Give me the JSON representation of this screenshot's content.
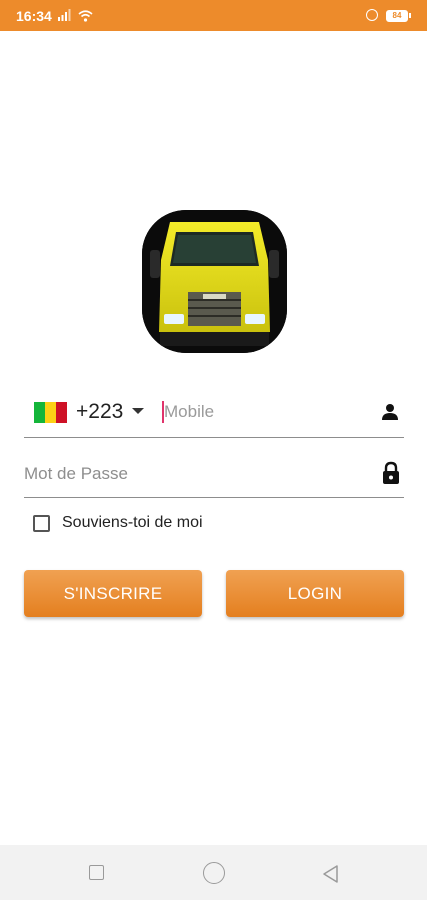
{
  "status_bar": {
    "time": "16:34",
    "battery_level": "84",
    "signal_icon": "signal-icon",
    "wifi_icon": "wifi-icon",
    "alarm_icon": "alarm-icon",
    "background_color": "#ed8b2b"
  },
  "logo": {
    "icon": "yellow-truck-logo"
  },
  "phone": {
    "country_code": "+223",
    "flag_colors": [
      "#14b53a",
      "#fcd116",
      "#ce1126"
    ],
    "mobile_placeholder": "Mobile",
    "person_icon": "person-icon"
  },
  "password": {
    "placeholder": "Mot de Passe",
    "lock_icon": "lock-icon"
  },
  "remember": {
    "label": "Souviens-toi de moi",
    "checked": false
  },
  "buttons": {
    "register_label": "S'INSCRIRE",
    "login_label": "LOGIN",
    "accent_color": "#ec8d2e"
  },
  "nav": {
    "recents_icon": "square-icon",
    "home_icon": "circle-icon",
    "back_icon": "triangle-back-icon"
  }
}
